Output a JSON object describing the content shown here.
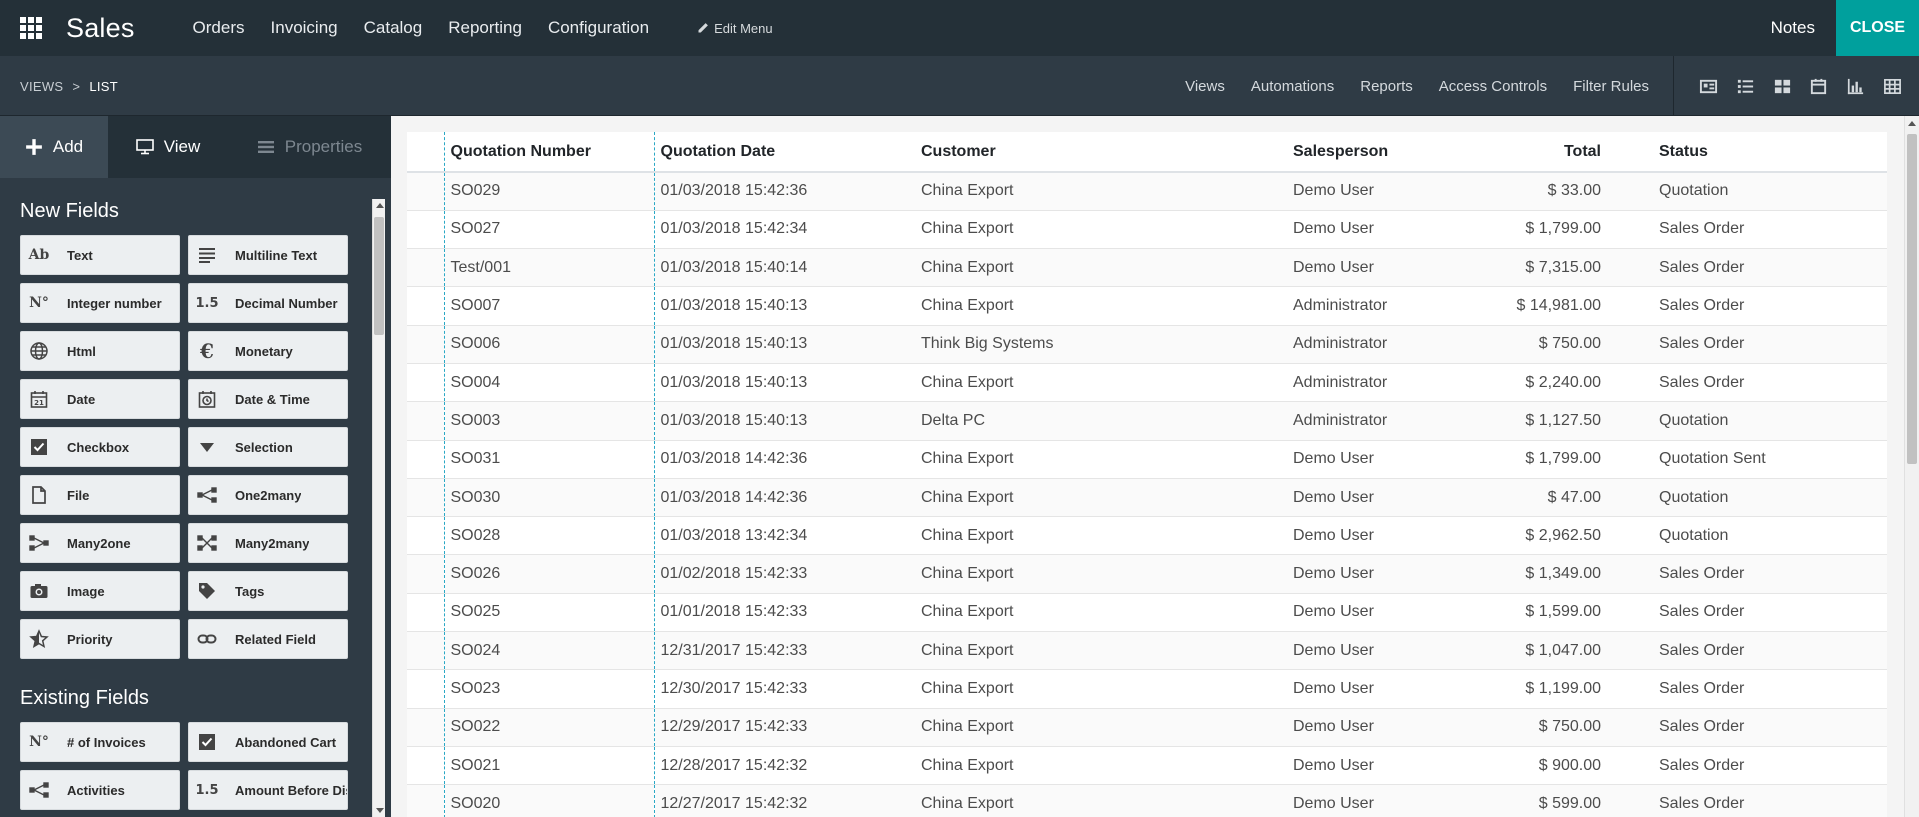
{
  "topbar": {
    "app_title": "Sales",
    "menu": [
      "Orders",
      "Invoicing",
      "Catalog",
      "Reporting",
      "Configuration"
    ],
    "edit_menu": "Edit Menu",
    "notes": "Notes",
    "close": "CLOSE",
    "accent": "#00a09d"
  },
  "subbar": {
    "breadcrumb": [
      "VIEWS",
      "LIST"
    ],
    "links": [
      "Views",
      "Automations",
      "Reports",
      "Access Controls",
      "Filter Rules"
    ],
    "view_icons": [
      "form-view-icon",
      "list-view-icon",
      "kanban-view-icon",
      "calendar-view-icon",
      "graph-view-icon",
      "pivot-view-icon"
    ]
  },
  "sidebar": {
    "tabs": {
      "add": "Add",
      "view": "View",
      "properties": "Properties"
    },
    "new_fields_title": "New Fields",
    "new_fields": [
      {
        "label": "Text",
        "icon": "text-icon"
      },
      {
        "label": "Multiline Text",
        "icon": "multiline-text-icon"
      },
      {
        "label": "Integer number",
        "icon": "integer-icon"
      },
      {
        "label": "Decimal Number",
        "icon": "decimal-icon"
      },
      {
        "label": "Html",
        "icon": "globe-icon"
      },
      {
        "label": "Monetary",
        "icon": "euro-icon"
      },
      {
        "label": "Date",
        "icon": "calendar-icon"
      },
      {
        "label": "Date & Time",
        "icon": "calendar-clock-icon"
      },
      {
        "label": "Checkbox",
        "icon": "checkbox-icon"
      },
      {
        "label": "Selection",
        "icon": "caret-down-icon"
      },
      {
        "label": "File",
        "icon": "file-icon"
      },
      {
        "label": "One2many",
        "icon": "one2many-icon"
      },
      {
        "label": "Many2one",
        "icon": "many2one-icon"
      },
      {
        "label": "Many2many",
        "icon": "many2many-icon"
      },
      {
        "label": "Image",
        "icon": "camera-icon"
      },
      {
        "label": "Tags",
        "icon": "tag-icon"
      },
      {
        "label": "Priority",
        "icon": "star-icon"
      },
      {
        "label": "Related Field",
        "icon": "link-icon"
      }
    ],
    "existing_fields_title": "Existing Fields",
    "existing_fields": [
      {
        "label": "# of Invoices",
        "icon": "integer-icon"
      },
      {
        "label": "Abandoned Cart",
        "icon": "checkbox-icon"
      },
      {
        "label": "Activities",
        "icon": "one2many-icon"
      },
      {
        "label": "Amount Before Discount",
        "icon": "decimal-icon"
      }
    ]
  },
  "table": {
    "columns": [
      "Quotation Number",
      "Quotation Date",
      "Customer",
      "Salesperson",
      "Total",
      "Status"
    ],
    "rows": [
      [
        "SO029",
        "01/03/2018 15:42:36",
        "China Export",
        "Demo User",
        "$ 33.00",
        "Quotation"
      ],
      [
        "SO027",
        "01/03/2018 15:42:34",
        "China Export",
        "Demo User",
        "$ 1,799.00",
        "Sales Order"
      ],
      [
        "Test/001",
        "01/03/2018 15:40:14",
        "China Export",
        "Demo User",
        "$ 7,315.00",
        "Sales Order"
      ],
      [
        "SO007",
        "01/03/2018 15:40:13",
        "China Export",
        "Administrator",
        "$ 14,981.00",
        "Sales Order"
      ],
      [
        "SO006",
        "01/03/2018 15:40:13",
        "Think Big Systems",
        "Administrator",
        "$ 750.00",
        "Sales Order"
      ],
      [
        "SO004",
        "01/03/2018 15:40:13",
        "China Export",
        "Administrator",
        "$ 2,240.00",
        "Sales Order"
      ],
      [
        "SO003",
        "01/03/2018 15:40:13",
        "Delta PC",
        "Administrator",
        "$ 1,127.50",
        "Quotation"
      ],
      [
        "SO031",
        "01/03/2018 14:42:36",
        "China Export",
        "Demo User",
        "$ 1,799.00",
        "Quotation Sent"
      ],
      [
        "SO030",
        "01/03/2018 14:42:36",
        "China Export",
        "Demo User",
        "$ 47.00",
        "Quotation"
      ],
      [
        "SO028",
        "01/03/2018 13:42:34",
        "China Export",
        "Demo User",
        "$ 2,962.50",
        "Quotation"
      ],
      [
        "SO026",
        "01/02/2018 15:42:33",
        "China Export",
        "Demo User",
        "$ 1,349.00",
        "Sales Order"
      ],
      [
        "SO025",
        "01/01/2018 15:42:33",
        "China Export",
        "Demo User",
        "$ 1,599.00",
        "Sales Order"
      ],
      [
        "SO024",
        "12/31/2017 15:42:33",
        "China Export",
        "Demo User",
        "$ 1,047.00",
        "Sales Order"
      ],
      [
        "SO023",
        "12/30/2017 15:42:33",
        "China Export",
        "Demo User",
        "$ 1,199.00",
        "Sales Order"
      ],
      [
        "SO022",
        "12/29/2017 15:42:33",
        "China Export",
        "Demo User",
        "$ 750.00",
        "Sales Order"
      ],
      [
        "SO021",
        "12/28/2017 15:42:32",
        "China Export",
        "Demo User",
        "$ 900.00",
        "Sales Order"
      ],
      [
        "SO020",
        "12/27/2017 15:42:32",
        "China Export",
        "Demo User",
        "$ 599.00",
        "Sales Order"
      ]
    ]
  }
}
